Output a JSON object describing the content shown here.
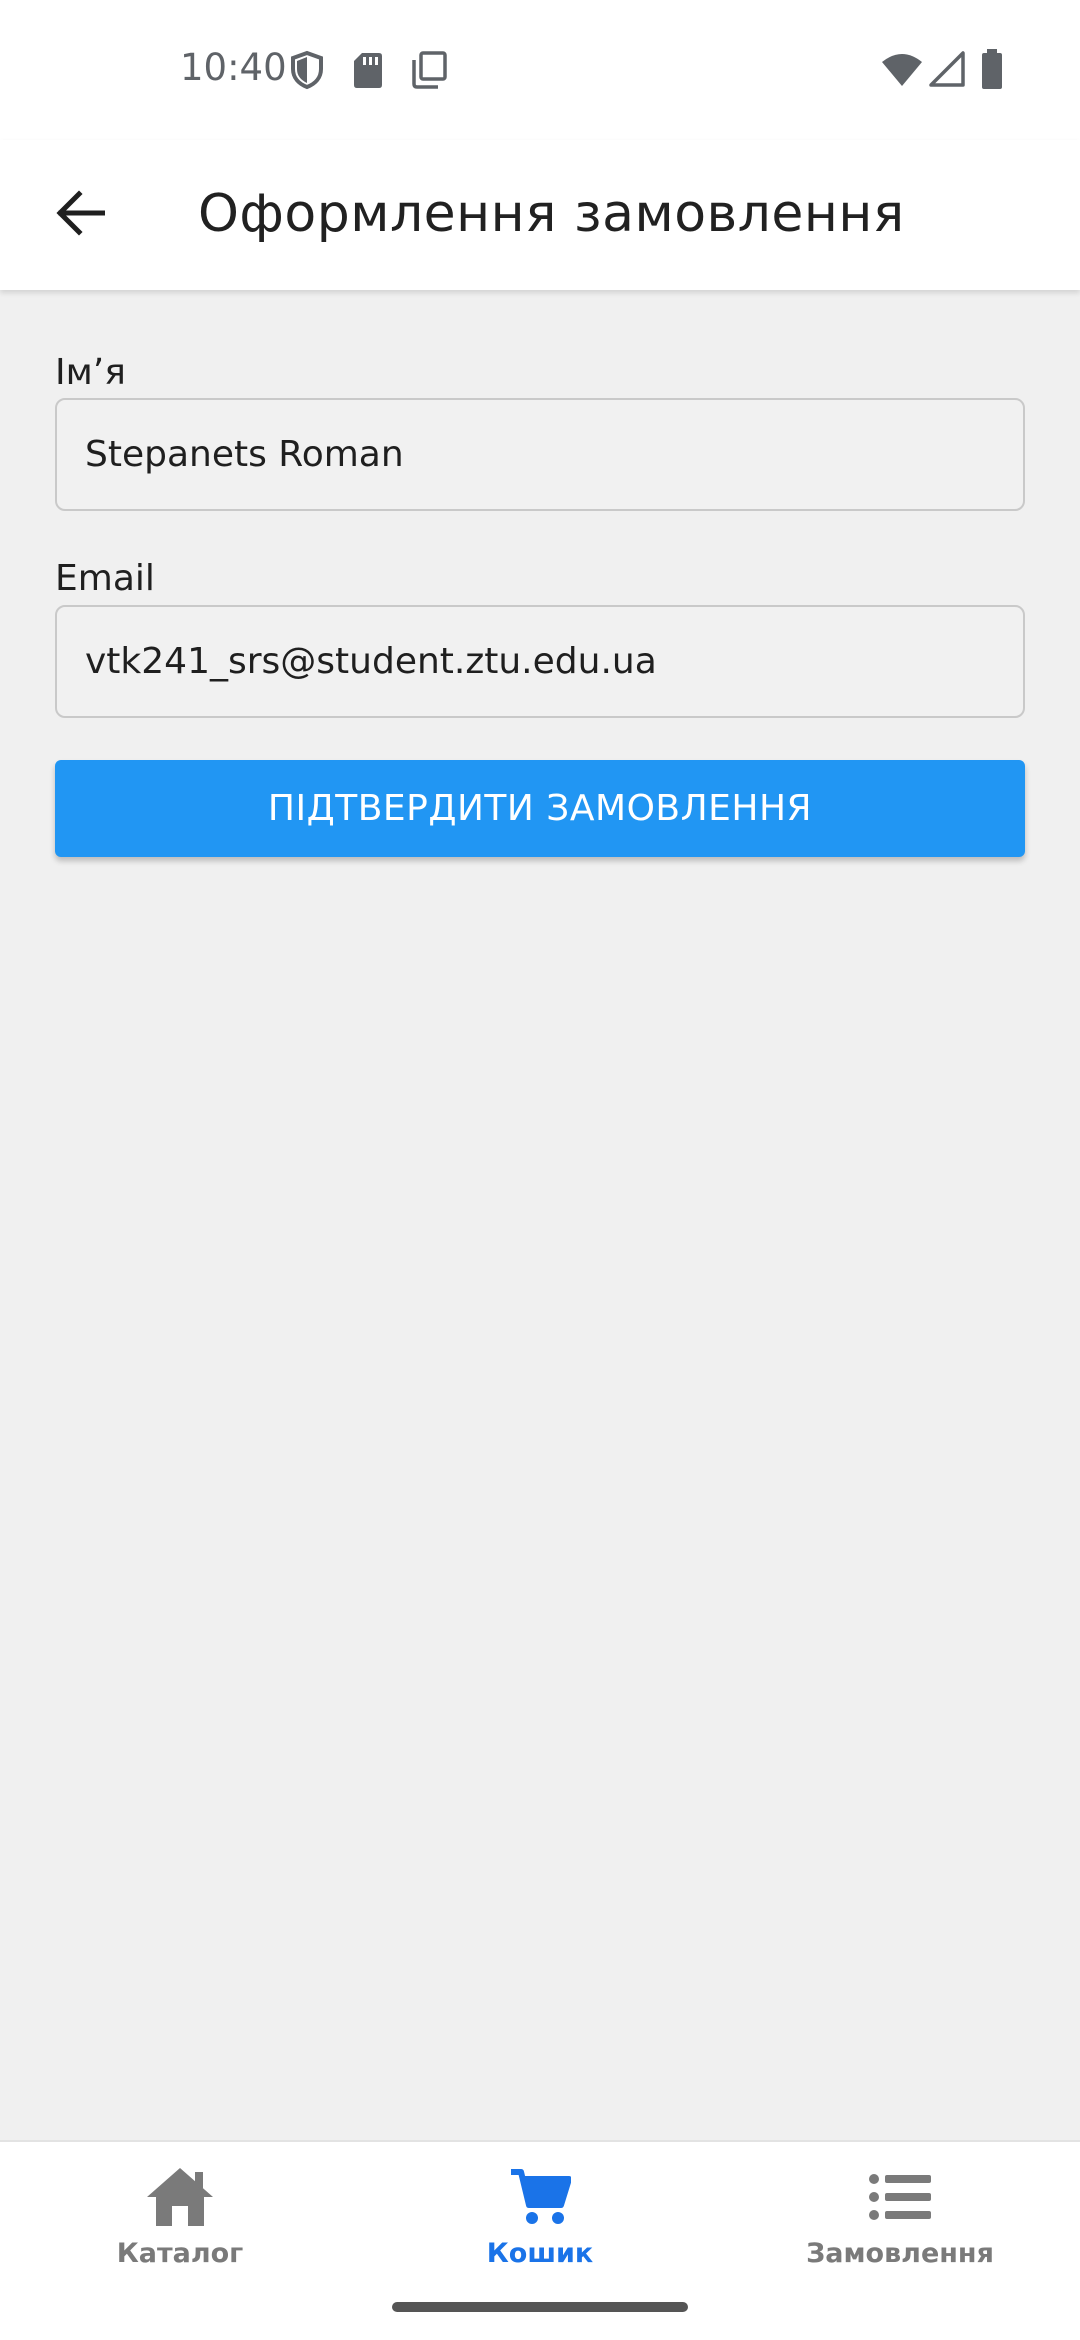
{
  "status_bar": {
    "time": "10:40",
    "left_icons": [
      "shield-icon",
      "sd-card-icon",
      "copy-icon"
    ],
    "right_icons": [
      "wifi-icon",
      "signal-icon",
      "battery-icon"
    ]
  },
  "app_bar": {
    "title": "Оформлення замовлення",
    "back_icon": "arrow-back-icon"
  },
  "form": {
    "name_label": "Ім’я",
    "name_value": "Stepanets Roman",
    "email_label": "Email",
    "email_value": "vtk241_srs@student.ztu.edu.ua",
    "submit_label": "ПІДТВЕРДИТИ ЗАМОВЛЕННЯ"
  },
  "bottom_nav": {
    "items": [
      {
        "label": "Каталог",
        "icon": "home-icon",
        "active": false
      },
      {
        "label": "Кошик",
        "icon": "cart-icon",
        "active": true
      },
      {
        "label": "Замовлення",
        "icon": "list-icon",
        "active": false
      }
    ]
  },
  "colors": {
    "accent": "#2196f3",
    "active_nav": "#1a73e8",
    "inactive_nav": "#7a7a7a",
    "background": "#f0f0f0"
  }
}
